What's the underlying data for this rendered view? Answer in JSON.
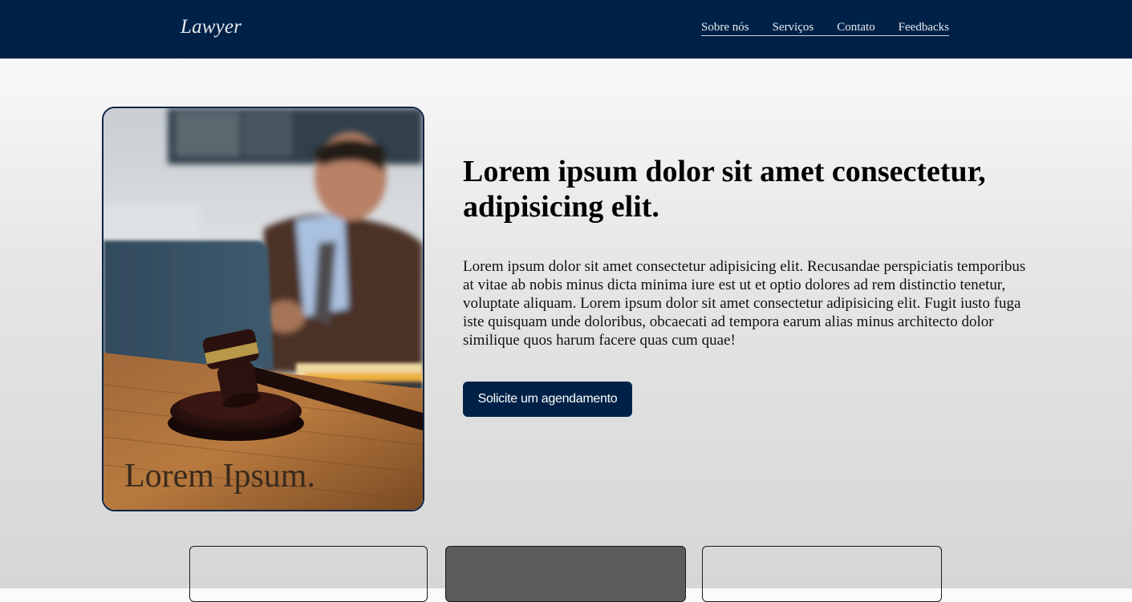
{
  "header": {
    "logo": "Lawyer",
    "nav": [
      "Sobre nós",
      "Serviços",
      "Contato",
      "Feedbacks"
    ]
  },
  "hero": {
    "image_caption": "Lorem Ipsum.",
    "title": "Lorem ipsum dolor sit amet consectetur, adipisicing elit.",
    "text": "Lorem ipsum dolor sit amet consectetur adipisicing elit. Recusandae perspiciatis temporibus at vitae ab nobis minus dicta minima iure est ut et optio dolores ad rem distinctio tenetur, voluptate aliquam. Lorem ipsum dolor sit amet consectetur adipisicing elit. Fugit iusto fuga iste quisquam unde doloribus, obcaecati ad tempora earum alias minus architecto dolor similique quos harum facere quas cum quae!",
    "cta_label": "Solicite um agendamento"
  },
  "colors": {
    "primary": "#002147",
    "feature_dark": "#5c5c5c"
  },
  "icons": [
    "lawyer-gavel-photo"
  ]
}
